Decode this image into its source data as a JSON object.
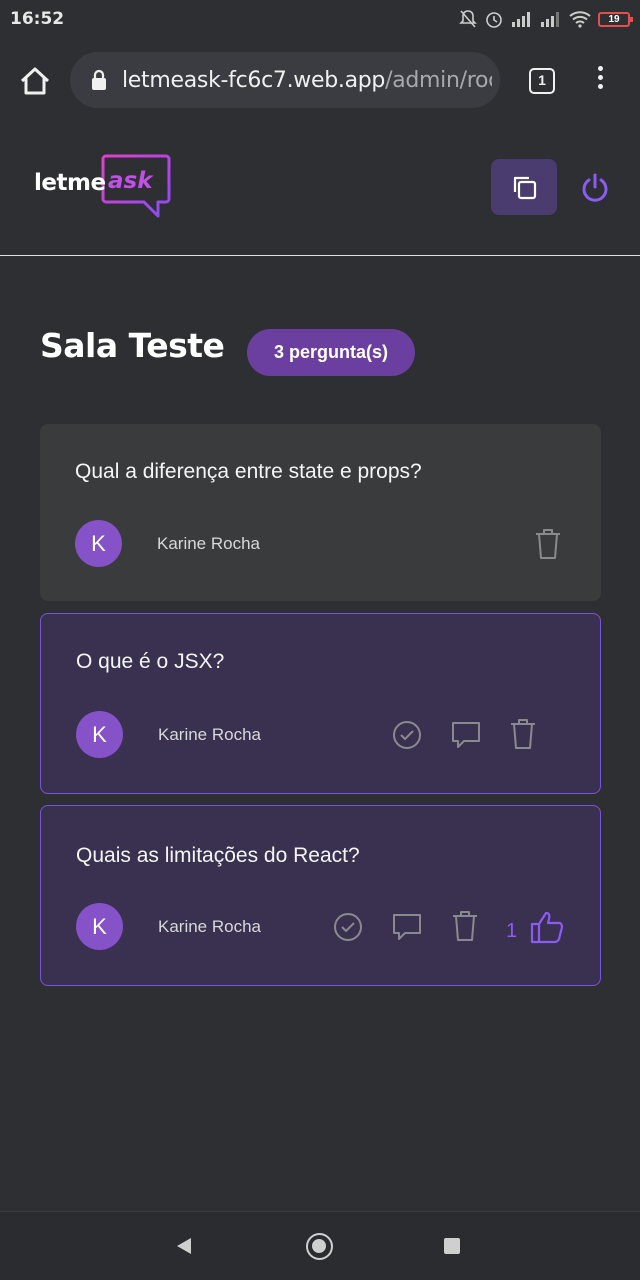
{
  "status": {
    "time": "16:52",
    "battery": "19"
  },
  "browser": {
    "url_host": "letmeask-fc6c7.web.app",
    "url_path": "/admin/roc",
    "tab_count": "1"
  },
  "header": {
    "logo_letme": "letme",
    "logo_ask": "ask"
  },
  "room": {
    "title": "Sala Teste",
    "count_badge": "3 pergunta(s)"
  },
  "questions": [
    {
      "text": "Qual a diferença entre state e props?",
      "author": "Karine Rocha",
      "avatar_initial": "K"
    },
    {
      "text": "O que é o JSX?",
      "author": "Karine Rocha",
      "avatar_initial": "K"
    },
    {
      "text": "Quais as limitações do React?",
      "author": "Karine Rocha",
      "avatar_initial": "K",
      "likes": "1"
    }
  ],
  "colors": {
    "accent": "#8a5cf5",
    "badge": "#6b3fa0",
    "avatar": "#8552c8"
  }
}
